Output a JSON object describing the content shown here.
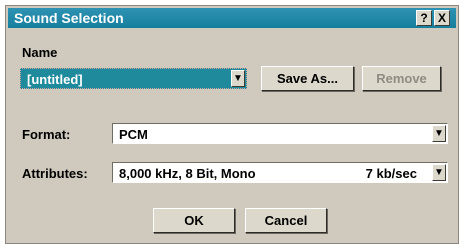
{
  "window": {
    "title": "Sound Selection",
    "help_label": "?",
    "close_label": "X"
  },
  "name_section": {
    "label": "Name",
    "value": "[untitled]",
    "dropdown_icon": "chevron-down-icon"
  },
  "buttons": {
    "save_as": "Save As...",
    "remove": "Remove",
    "ok": "OK",
    "cancel": "Cancel"
  },
  "format": {
    "label": "Format:",
    "value": "PCM"
  },
  "attributes": {
    "label": "Attributes:",
    "value": "8,000 kHz, 8 Bit, Mono",
    "rate": "7 kb/sec"
  },
  "colors": {
    "titlebar": "#1d86a6",
    "selection": "#1e8a9c",
    "dialog_bg": "#cfcabd"
  }
}
